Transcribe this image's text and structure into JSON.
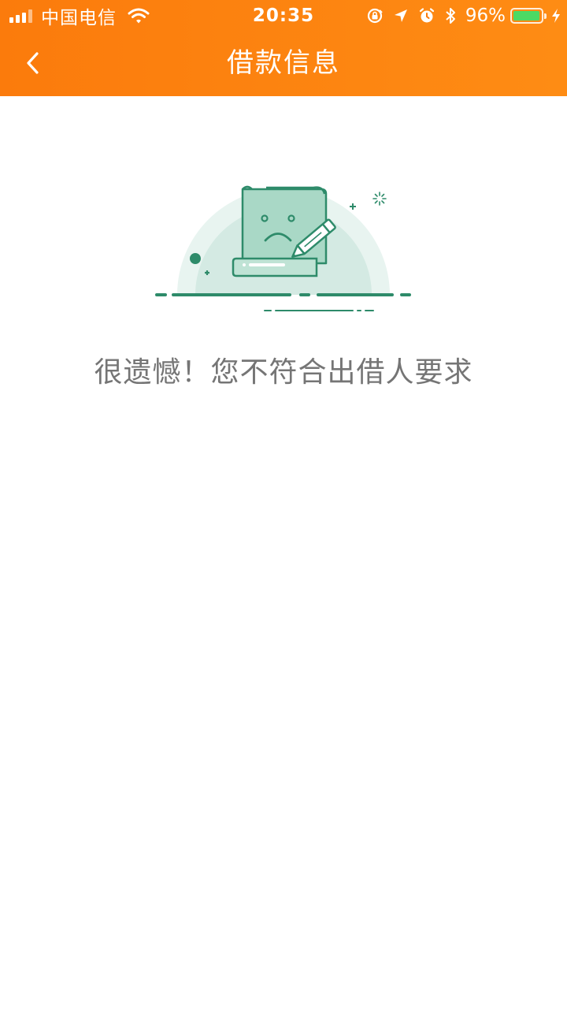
{
  "status_bar": {
    "carrier": "中国电信",
    "time": "20:35",
    "battery_percent": "96%",
    "battery_level": 0.96,
    "icons": [
      "signal-icon",
      "wifi-icon",
      "rotation-lock-icon",
      "location-icon",
      "alarm-icon",
      "bluetooth-icon",
      "battery-icon",
      "charging-icon"
    ]
  },
  "nav": {
    "back_icon": "chevron-left-icon",
    "title": "借款信息"
  },
  "empty_state": {
    "illustration": "sad-document-pencil-illustration",
    "message": "很遗憾！您不符合出借人要求"
  },
  "colors": {
    "header_orange": "#fb7b0c",
    "illustration_green": "#2e8b6a",
    "illustration_light": "#e6f3ef",
    "message_text": "#757575"
  }
}
